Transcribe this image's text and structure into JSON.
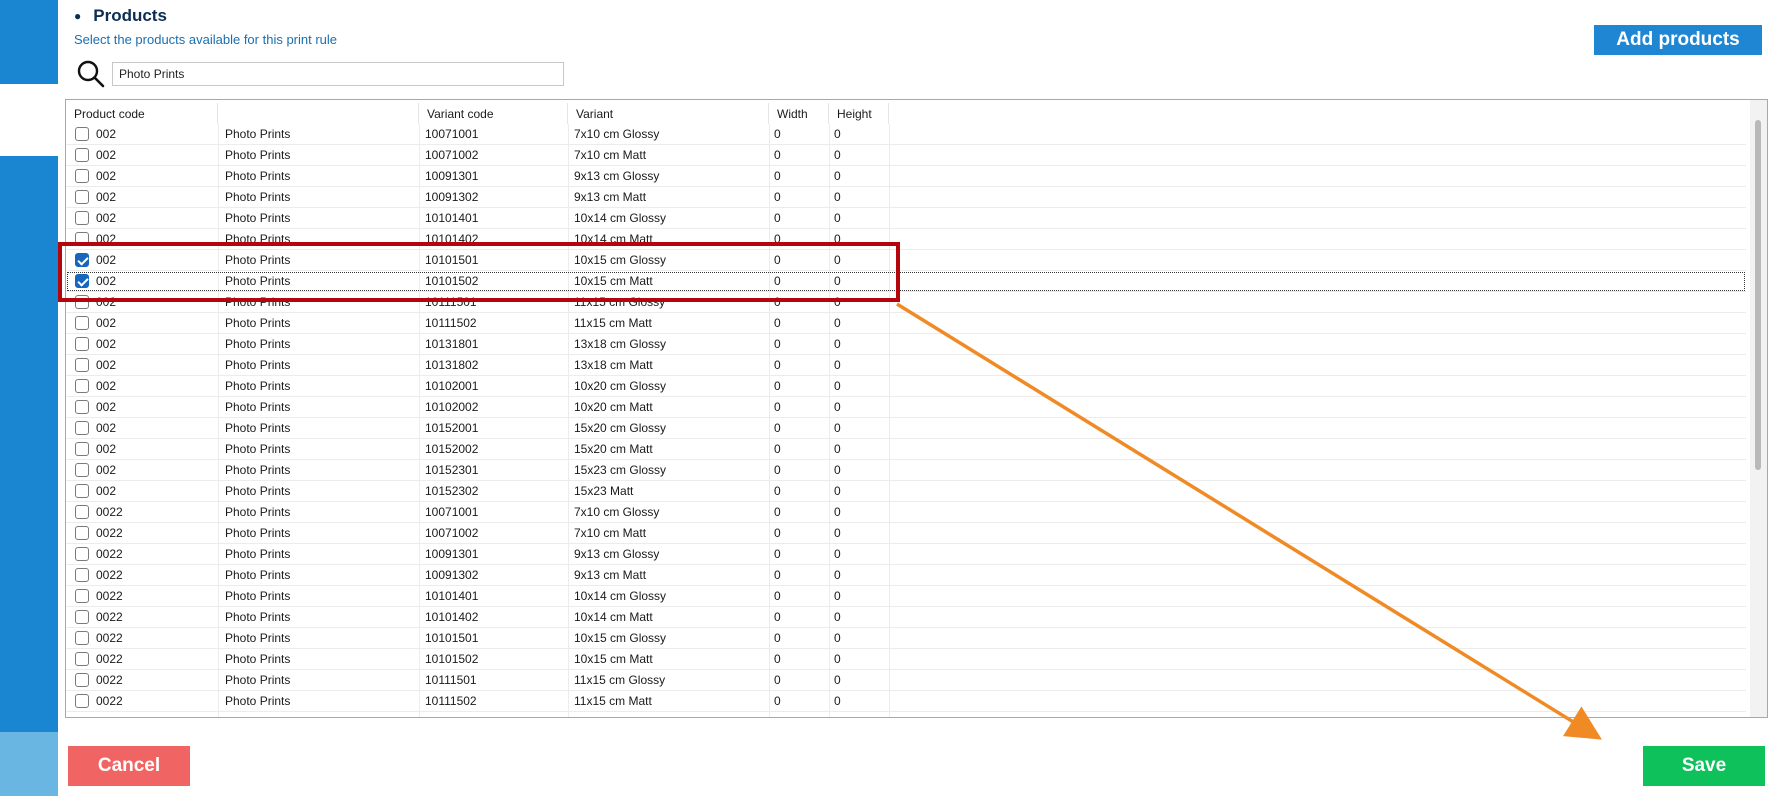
{
  "header": {
    "title": "Products",
    "subtitle": "Select the products available for this print rule",
    "add_products_label": "Add products"
  },
  "search": {
    "value": "Photo Prints",
    "icon": "search-icon"
  },
  "table": {
    "columns": [
      "Product code",
      "",
      "Variant code",
      "Variant",
      "Width",
      "Height"
    ],
    "rows": [
      {
        "checked": false,
        "code": "002",
        "name": "Photo Prints",
        "variant_code": "10071001",
        "variant": "7x10 cm Glossy",
        "width": "0",
        "height": "0"
      },
      {
        "checked": false,
        "code": "002",
        "name": "Photo Prints",
        "variant_code": "10071002",
        "variant": "7x10 cm  Matt",
        "width": "0",
        "height": "0"
      },
      {
        "checked": false,
        "code": "002",
        "name": "Photo Prints",
        "variant_code": "10091301",
        "variant": "9x13 cm Glossy",
        "width": "0",
        "height": "0"
      },
      {
        "checked": false,
        "code": "002",
        "name": "Photo Prints",
        "variant_code": "10091302",
        "variant": "9x13 cm Matt",
        "width": "0",
        "height": "0"
      },
      {
        "checked": false,
        "code": "002",
        "name": "Photo Prints",
        "variant_code": "10101401",
        "variant": "10x14 cm Glossy",
        "width": "0",
        "height": "0"
      },
      {
        "checked": false,
        "code": "002",
        "name": "Photo Prints",
        "variant_code": "10101402",
        "variant": "10x14 cm Matt",
        "width": "0",
        "height": "0"
      },
      {
        "checked": true,
        "code": "002",
        "name": "Photo Prints",
        "variant_code": "10101501",
        "variant": "10x15 cm Glossy",
        "width": "0",
        "height": "0"
      },
      {
        "checked": true,
        "code": "002",
        "name": "Photo Prints",
        "variant_code": "10101502",
        "variant": "10x15 cm Matt",
        "width": "0",
        "height": "0",
        "focused": true
      },
      {
        "checked": false,
        "code": "002",
        "name": "Photo Prints",
        "variant_code": "10111501",
        "variant": "11x15 cm Glossy",
        "width": "0",
        "height": "0"
      },
      {
        "checked": false,
        "code": "002",
        "name": "Photo Prints",
        "variant_code": "10111502",
        "variant": "11x15 cm Matt",
        "width": "0",
        "height": "0"
      },
      {
        "checked": false,
        "code": "002",
        "name": "Photo Prints",
        "variant_code": "10131801",
        "variant": "13x18 cm Glossy",
        "width": "0",
        "height": "0"
      },
      {
        "checked": false,
        "code": "002",
        "name": "Photo Prints",
        "variant_code": "10131802",
        "variant": "13x18 cm Matt",
        "width": "0",
        "height": "0"
      },
      {
        "checked": false,
        "code": "002",
        "name": "Photo Prints",
        "variant_code": "10102001",
        "variant": "10x20 cm Glossy",
        "width": "0",
        "height": "0"
      },
      {
        "checked": false,
        "code": "002",
        "name": "Photo Prints",
        "variant_code": "10102002",
        "variant": "10x20 cm Matt",
        "width": "0",
        "height": "0"
      },
      {
        "checked": false,
        "code": "002",
        "name": "Photo Prints",
        "variant_code": "10152001",
        "variant": "15x20 cm Glossy",
        "width": "0",
        "height": "0"
      },
      {
        "checked": false,
        "code": "002",
        "name": "Photo Prints",
        "variant_code": "10152002",
        "variant": "15x20 cm Matt",
        "width": "0",
        "height": "0"
      },
      {
        "checked": false,
        "code": "002",
        "name": "Photo Prints",
        "variant_code": "10152301",
        "variant": "15x23 cm Glossy",
        "width": "0",
        "height": "0"
      },
      {
        "checked": false,
        "code": "002",
        "name": "Photo Prints",
        "variant_code": "10152302",
        "variant": "15x23 Matt",
        "width": "0",
        "height": "0"
      },
      {
        "checked": false,
        "code": "0022",
        "name": "Photo Prints",
        "variant_code": "10071001",
        "variant": "7x10 cm Glossy",
        "width": "0",
        "height": "0"
      },
      {
        "checked": false,
        "code": "0022",
        "name": "Photo Prints",
        "variant_code": "10071002",
        "variant": "7x10 cm  Matt",
        "width": "0",
        "height": "0"
      },
      {
        "checked": false,
        "code": "0022",
        "name": "Photo Prints",
        "variant_code": "10091301",
        "variant": "9x13 cm Glossy",
        "width": "0",
        "height": "0"
      },
      {
        "checked": false,
        "code": "0022",
        "name": "Photo Prints",
        "variant_code": "10091302",
        "variant": "9x13 cm Matt",
        "width": "0",
        "height": "0"
      },
      {
        "checked": false,
        "code": "0022",
        "name": "Photo Prints",
        "variant_code": "10101401",
        "variant": "10x14 cm Glossy",
        "width": "0",
        "height": "0"
      },
      {
        "checked": false,
        "code": "0022",
        "name": "Photo Prints",
        "variant_code": "10101402",
        "variant": "10x14 cm Matt",
        "width": "0",
        "height": "0"
      },
      {
        "checked": false,
        "code": "0022",
        "name": "Photo Prints",
        "variant_code": "10101501",
        "variant": "10x15 cm Glossy",
        "width": "0",
        "height": "0"
      },
      {
        "checked": false,
        "code": "0022",
        "name": "Photo Prints",
        "variant_code": "10101502",
        "variant": "10x15 cm Matt",
        "width": "0",
        "height": "0"
      },
      {
        "checked": false,
        "code": "0022",
        "name": "Photo Prints",
        "variant_code": "10111501",
        "variant": "11x15 cm Glossy",
        "width": "0",
        "height": "0"
      },
      {
        "checked": false,
        "code": "0022",
        "name": "Photo Prints",
        "variant_code": "10111502",
        "variant": "11x15 cm Matt",
        "width": "0",
        "height": "0"
      }
    ]
  },
  "footer": {
    "cancel_label": "Cancel",
    "save_label": "Save"
  },
  "colors": {
    "accent": "#1f86d3",
    "cancel": "#f06464",
    "save": "#0ec15b",
    "annotation_box": "#b5050c",
    "annotation_arrow": "#f08a24"
  }
}
